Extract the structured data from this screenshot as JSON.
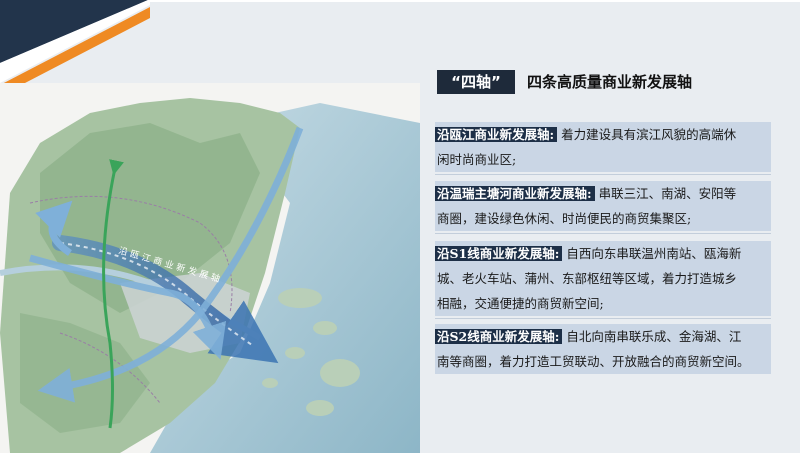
{
  "title": {
    "tag": "“四轴”",
    "text": "四条高质量商业新发展轴"
  },
  "axes": [
    {
      "name": "沿瓯江商业新发展轴:",
      "lines": [
        "着力建设具有滨江风貌的高端休",
        "闲时尚商业区;"
      ]
    },
    {
      "name": "沿温瑞主塘河商业新发展轴:",
      "lines": [
        "串联三江、南湖、安阳等",
        "商圈，建设绿色休闲、时尚便民的商贸集聚区;"
      ]
    },
    {
      "name": "沿S1线商业新发展轴:",
      "lines": [
        "自西向东串联温州南站、瓯海新",
        "城、老火车站、蒲州、东部枢纽等区域，着力打造城乡",
        "相融，交通便捷的商贸新空间;"
      ]
    },
    {
      "name": "沿S2线商业新发展轴:",
      "lines": [
        "自北向南串联乐成、金海湖、江",
        "南等商圈，着力打造工贸联动、开放融合的商贸新空间。"
      ]
    }
  ],
  "map": {
    "axis_label": "沿瓯江商业新发展轴"
  },
  "colors": {
    "navy": "#1d2f47",
    "orange": "#ef8a23",
    "panel": "#cad6e5",
    "sea": "#9fc2d2",
    "land": "#9dbb99"
  }
}
